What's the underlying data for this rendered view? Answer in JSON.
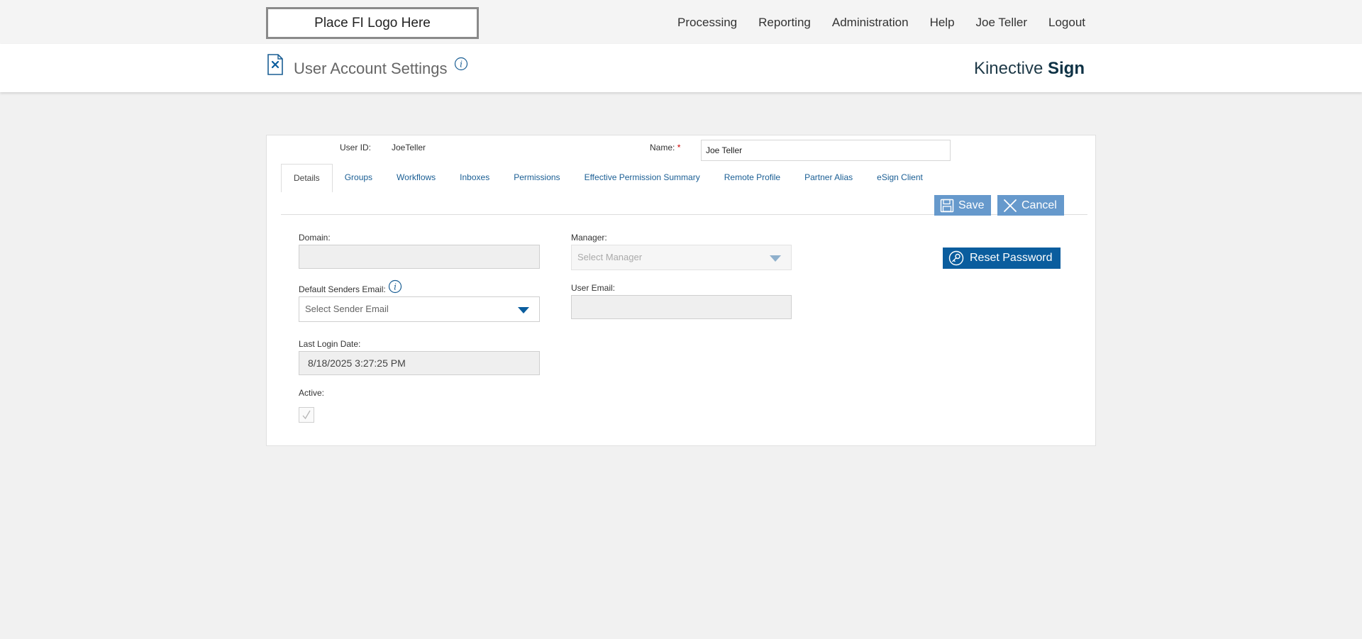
{
  "header": {
    "logo_text": "Place FI Logo Here",
    "nav": [
      "Processing",
      "Reporting",
      "Administration",
      "Help",
      "Joe Teller",
      "Logout"
    ],
    "page_title": "User Account Settings",
    "brand_light": "Kinective ",
    "brand_bold": "Sign"
  },
  "user": {
    "user_id_label": "User ID:",
    "user_id_value": "JoeTeller",
    "name_label": "Name:",
    "name_required": "*",
    "name_value": "Joe Teller"
  },
  "tabs": [
    "Details",
    "Groups",
    "Workflows",
    "Inboxes",
    "Permissions",
    "Effective Permission Summary",
    "Remote Profile",
    "Partner Alias",
    "eSign Client"
  ],
  "actions": {
    "save_label": "Save",
    "cancel_label": "Cancel",
    "reset_password_label": "Reset Password"
  },
  "details": {
    "domain_label": "Domain:",
    "domain_value": "",
    "manager_label": "Manager:",
    "manager_placeholder": "Select Manager",
    "default_senders_email_label": "Default Senders Email:",
    "default_senders_email_placeholder": "Select Sender Email",
    "user_email_label": "User Email:",
    "user_email_value": "",
    "last_login_label": "Last Login Date:",
    "last_login_value": "8/18/2025 3:27:25 PM",
    "active_label": "Active:",
    "active_checked": true
  },
  "colors": {
    "accent": "#0a5d9e",
    "button_light": "#6699cc",
    "link": "#1a5e94",
    "required": "#cc0000"
  }
}
